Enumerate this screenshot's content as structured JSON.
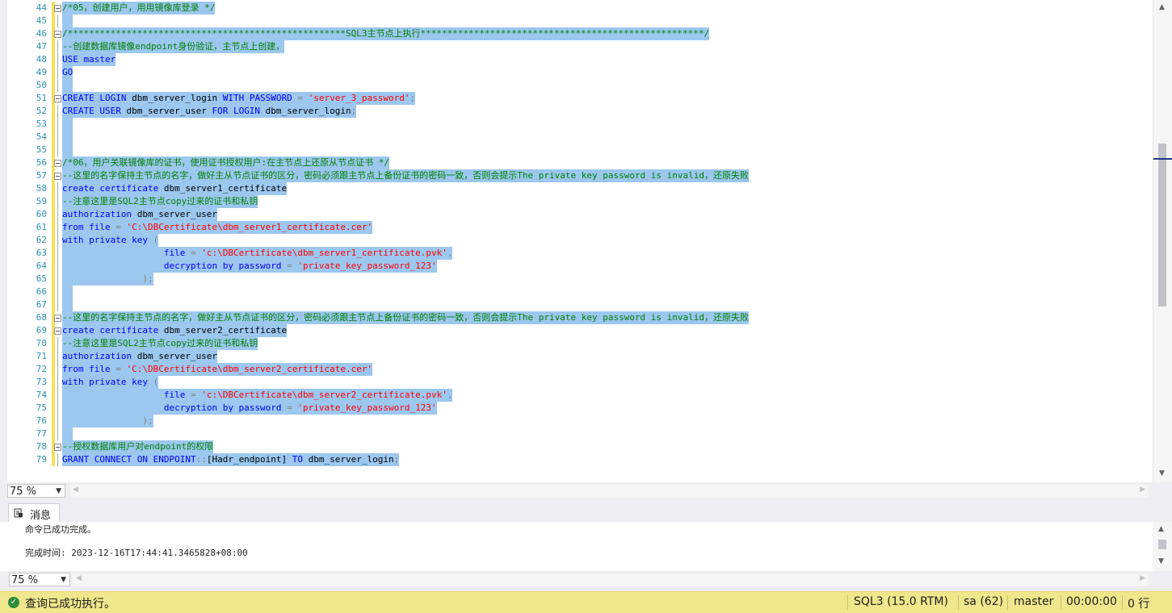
{
  "editor": {
    "lines": [
      {
        "n": "44",
        "fold": true,
        "segs": [
          [
            "cm",
            "/*05，创建用户，用用镜像库登录 */"
          ]
        ]
      },
      {
        "n": "45",
        "segs": []
      },
      {
        "n": "46",
        "fold": true,
        "segs": [
          [
            "cm",
            "/****************************************************SQL3主节点上执行*****************************************************/"
          ]
        ]
      },
      {
        "n": "47",
        "segs": [
          [
            "cm",
            "--创建数据库镜像endpoint身份验证，主节点上创建，"
          ]
        ]
      },
      {
        "n": "48",
        "segs": [
          [
            "kw",
            "USE"
          ],
          [
            "tx",
            " "
          ],
          [
            "kw",
            "master"
          ]
        ]
      },
      {
        "n": "49",
        "segs": [
          [
            "kw",
            "GO"
          ]
        ]
      },
      {
        "n": "50",
        "segs": []
      },
      {
        "n": "51",
        "fold": true,
        "segs": [
          [
            "kw",
            "CREATE LOGIN"
          ],
          [
            "tx",
            " dbm_server_login "
          ],
          [
            "kw",
            "WITH PASSWORD"
          ],
          [
            "op",
            " = "
          ],
          [
            "st",
            "'server_3_password'"
          ],
          [
            "op",
            ";"
          ]
        ]
      },
      {
        "n": "52",
        "segs": [
          [
            "kw",
            "CREATE USER"
          ],
          [
            "tx",
            " dbm_server_user "
          ],
          [
            "kw",
            "FOR LOGIN"
          ],
          [
            "tx",
            " dbm_server_login"
          ],
          [
            "op",
            ";"
          ]
        ]
      },
      {
        "n": "53",
        "segs": []
      },
      {
        "n": "54",
        "segs": []
      },
      {
        "n": "55",
        "segs": []
      },
      {
        "n": "56",
        "fold": true,
        "segs": [
          [
            "cm",
            "/*06，用户关联镜像库的证书，使用证书授权用户:在主节点上还原从节点证书 */"
          ]
        ]
      },
      {
        "n": "57",
        "fold": true,
        "segs": [
          [
            "cm",
            "--这里的名字保持主节点的名字，做好主从节点证书的区分，密码必须跟主节点上备份证书的密码一致，否则会提示The private key password is invalid，还原失败"
          ]
        ]
      },
      {
        "n": "58",
        "segs": [
          [
            "kw",
            "create certificate"
          ],
          [
            "tx",
            " dbm_server1_certificate"
          ]
        ]
      },
      {
        "n": "59",
        "segs": [
          [
            "cm",
            "--注意这里是SQL2主节点copy过来的证书和私钥"
          ]
        ]
      },
      {
        "n": "60",
        "segs": [
          [
            "kw",
            "authorization"
          ],
          [
            "tx",
            " dbm_server_user"
          ]
        ]
      },
      {
        "n": "61",
        "segs": [
          [
            "kw",
            "from file"
          ],
          [
            "op",
            " = "
          ],
          [
            "st",
            "'C:\\DBCertificate\\dbm_server1_certificate.cer'"
          ]
        ]
      },
      {
        "n": "62",
        "segs": [
          [
            "kw",
            "with private key"
          ],
          [
            "op",
            " ("
          ]
        ]
      },
      {
        "n": "63",
        "segs": [
          [
            "tx",
            "                   "
          ],
          [
            "kw",
            "file"
          ],
          [
            "op",
            " = "
          ],
          [
            "st",
            "'c:\\DBCertificate\\dbm_server1_certificate.pvk'"
          ],
          [
            "op",
            ","
          ]
        ]
      },
      {
        "n": "64",
        "segs": [
          [
            "tx",
            "                   "
          ],
          [
            "kw",
            "decryption by password"
          ],
          [
            "op",
            " = "
          ],
          [
            "st",
            "'private_key_password_123'"
          ]
        ]
      },
      {
        "n": "65",
        "segs": [
          [
            "tx",
            "               "
          ],
          [
            "op",
            ");"
          ]
        ]
      },
      {
        "n": "66",
        "segs": []
      },
      {
        "n": "67",
        "segs": []
      },
      {
        "n": "68",
        "fold": true,
        "segs": [
          [
            "cm",
            "--这里的名字保持主节点的名字，做好主从节点证书的区分，密码必须跟主节点上备份证书的密码一致，否则会提示The private key password is invalid，还原失败"
          ]
        ]
      },
      {
        "n": "69",
        "fold": true,
        "segs": [
          [
            "kw",
            "create certificate"
          ],
          [
            "tx",
            " dbm_server2_certificate"
          ]
        ]
      },
      {
        "n": "70",
        "segs": [
          [
            "cm",
            "--注意这里是SQL2主节点copy过来的证书和私钥"
          ]
        ]
      },
      {
        "n": "71",
        "segs": [
          [
            "kw",
            "authorization"
          ],
          [
            "tx",
            " dbm_server_user"
          ]
        ]
      },
      {
        "n": "72",
        "segs": [
          [
            "kw",
            "from file"
          ],
          [
            "op",
            " = "
          ],
          [
            "st",
            "'C:\\DBCertificate\\dbm_server2_certificate.cer'"
          ]
        ]
      },
      {
        "n": "73",
        "segs": [
          [
            "kw",
            "with private key"
          ],
          [
            "op",
            " ("
          ]
        ]
      },
      {
        "n": "74",
        "segs": [
          [
            "tx",
            "                   "
          ],
          [
            "kw",
            "file"
          ],
          [
            "op",
            " = "
          ],
          [
            "st",
            "'c:\\DBCertificate\\dbm_server2_certificate.pvk'"
          ],
          [
            "op",
            ","
          ]
        ]
      },
      {
        "n": "75",
        "segs": [
          [
            "tx",
            "                   "
          ],
          [
            "kw",
            "decryption by password"
          ],
          [
            "op",
            " = "
          ],
          [
            "st",
            "'private_key_password_123'"
          ]
        ]
      },
      {
        "n": "76",
        "segs": [
          [
            "tx",
            "               "
          ],
          [
            "op",
            ");"
          ]
        ]
      },
      {
        "n": "77",
        "segs": []
      },
      {
        "n": "78",
        "fold": true,
        "segs": [
          [
            "cm",
            "--授权数据库用户对endpoint的权限"
          ]
        ]
      },
      {
        "n": "79",
        "segs": [
          [
            "kw",
            "GRANT CONNECT ON ENDPOINT"
          ],
          [
            "op",
            "::"
          ],
          [
            "tx",
            "[Hadr_endpoint] "
          ],
          [
            "kw",
            "TO"
          ],
          [
            "tx",
            " dbm_server_login"
          ],
          [
            "op",
            ";"
          ]
        ]
      }
    ]
  },
  "zoom": {
    "editor": "75 %",
    "messages": "75 %"
  },
  "messages_tab": {
    "label": "消息",
    "icon": "messages-icon"
  },
  "messages": {
    "line1": "命令已成功完成。",
    "line2": "完成时间: 2023-12-16T17:44:41.3465828+08:00"
  },
  "status": {
    "message": "查询已成功执行。",
    "server": "SQL3 (15.0 RTM)",
    "user": "sa (62)",
    "database": "master",
    "elapsed": "00:00:00",
    "rows": "0 行"
  },
  "colors": {
    "status_bg": "#f0e68c",
    "selection": "#9cc7ef",
    "keyword": "#0000ff",
    "comment": "#008000",
    "string": "#ff0000"
  }
}
